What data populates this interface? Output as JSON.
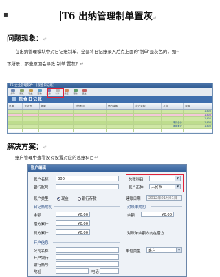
{
  "doc": {
    "bullet": "▪",
    "title": "T6 出纳管理制单置灰",
    "pm": "↵",
    "sections": {
      "problem": "问题现象：",
      "solution": "解决方案："
    },
    "paragraphs": {
      "p1": "在出纳管理模块中对日记账制单，全部将日记账录入后点上面的‘制单’是灰色的，如",
      "p2": "下所示，那些原因会导致‘制单’置灰？",
      "p3": "账户管理中查看没有设置对应的总账科目"
    }
  },
  "ledger": {
    "window_title": "T6-企业管理软件 - [现金日记账]",
    "toolbar_buttons": [
      "打印",
      "预览",
      "输出",
      "查询",
      "过滤",
      "制单",
      "凭证",
      "帮助",
      "退出"
    ],
    "banner": "现金日记账",
    "columns": [
      "日期",
      "凭证号",
      "摘要",
      "对方科目",
      "借方金额",
      "贷方金额",
      "方向",
      "余额"
    ],
    "rows": [
      {
        "style": "g",
        "cells": [
          "",
          "",
          "",
          "",
          "",
          "",
          "",
          "1,400"
        ]
      },
      {
        "style": "pk",
        "cells": [
          "",
          "",
          "",
          "",
          "",
          "",
          "",
          "1,400"
        ]
      },
      {
        "style": "g",
        "cells": [
          "",
          "",
          "",
          "",
          "",
          "",
          "",
          "1,400"
        ]
      },
      {
        "style": "g2",
        "cells": [
          "",
          "",
          "",
          "",
          "",
          "",
          "本月合计",
          "1,400"
        ]
      },
      {
        "style": "g",
        "cells": [
          "",
          "",
          "",
          "",
          "",
          "",
          "本年累计",
          "1,400"
        ]
      },
      {
        "style": "w",
        "cells": [
          "",
          "",
          "",
          "",
          "",
          "",
          "",
          ""
        ]
      }
    ]
  },
  "dialog": {
    "title": "账户编辑",
    "left_labels": [
      "账户名称",
      "银行账号"
    ],
    "account_name": "300",
    "subject_label": "总账科目",
    "currency_label": "账户币种",
    "currency_value": "人民币",
    "account_type_label": "账户类型",
    "radio_cash": "现金",
    "radio_bank": "银行存款",
    "open_date_label": "建账日期",
    "open_date_value": "2012年01月01日",
    "journal_group": "日记账期初",
    "reconcile_group": "对账单期初",
    "balance_label": "余额",
    "debit_total_label": "借方累计",
    "credit_total_label": "贷方累计",
    "amount_zero": "¥0.00",
    "reconcile_note": "对账单余额方向在借方",
    "branch_group": "开户信息",
    "branch_labels": [
      "公司名称",
      "开户银行",
      "银行账号",
      "地址"
    ],
    "phone_label": "电话",
    "unit_type_label": "单位类型",
    "unit_type_value": "客户"
  }
}
